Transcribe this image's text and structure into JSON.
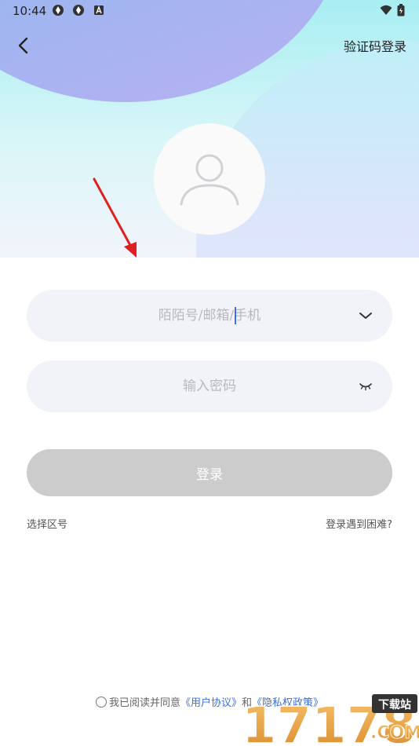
{
  "status_bar": {
    "time": "10:44",
    "icons": [
      "app-notification-icon",
      "app-notification-icon",
      "a-icon",
      "wifi-icon",
      "battery-icon"
    ]
  },
  "header": {
    "back_icon": "chevron-left-icon",
    "sms_login_label": "验证码登录"
  },
  "avatar": {
    "icon": "user-icon"
  },
  "form": {
    "account_placeholder": "陌陌号/邮箱/手机",
    "account_value": "",
    "account_dropdown_icon": "chevron-down-icon",
    "password_placeholder": "输入密码",
    "password_value": "",
    "password_toggle_icon": "eye-closed-icon",
    "login_label": "登录"
  },
  "links": {
    "region_label": "选择区号",
    "trouble_label": "登录遇到困难?"
  },
  "agreement": {
    "prefix": "我已阅读并同意",
    "user_agreement": "《用户协议》",
    "conjunction": "和",
    "privacy_policy": "《隐私权政策》"
  },
  "overlay": {
    "annotation_arrow": "red-arrow",
    "watermark_number": "17178",
    "watermark_tag": "下载站",
    "watermark_domain": ".COM"
  },
  "colors": {
    "accent": "#3f6fd8",
    "button_disabled": "#cccccc",
    "input_bg": "#f2f3f8",
    "arrow": "#e02020"
  }
}
